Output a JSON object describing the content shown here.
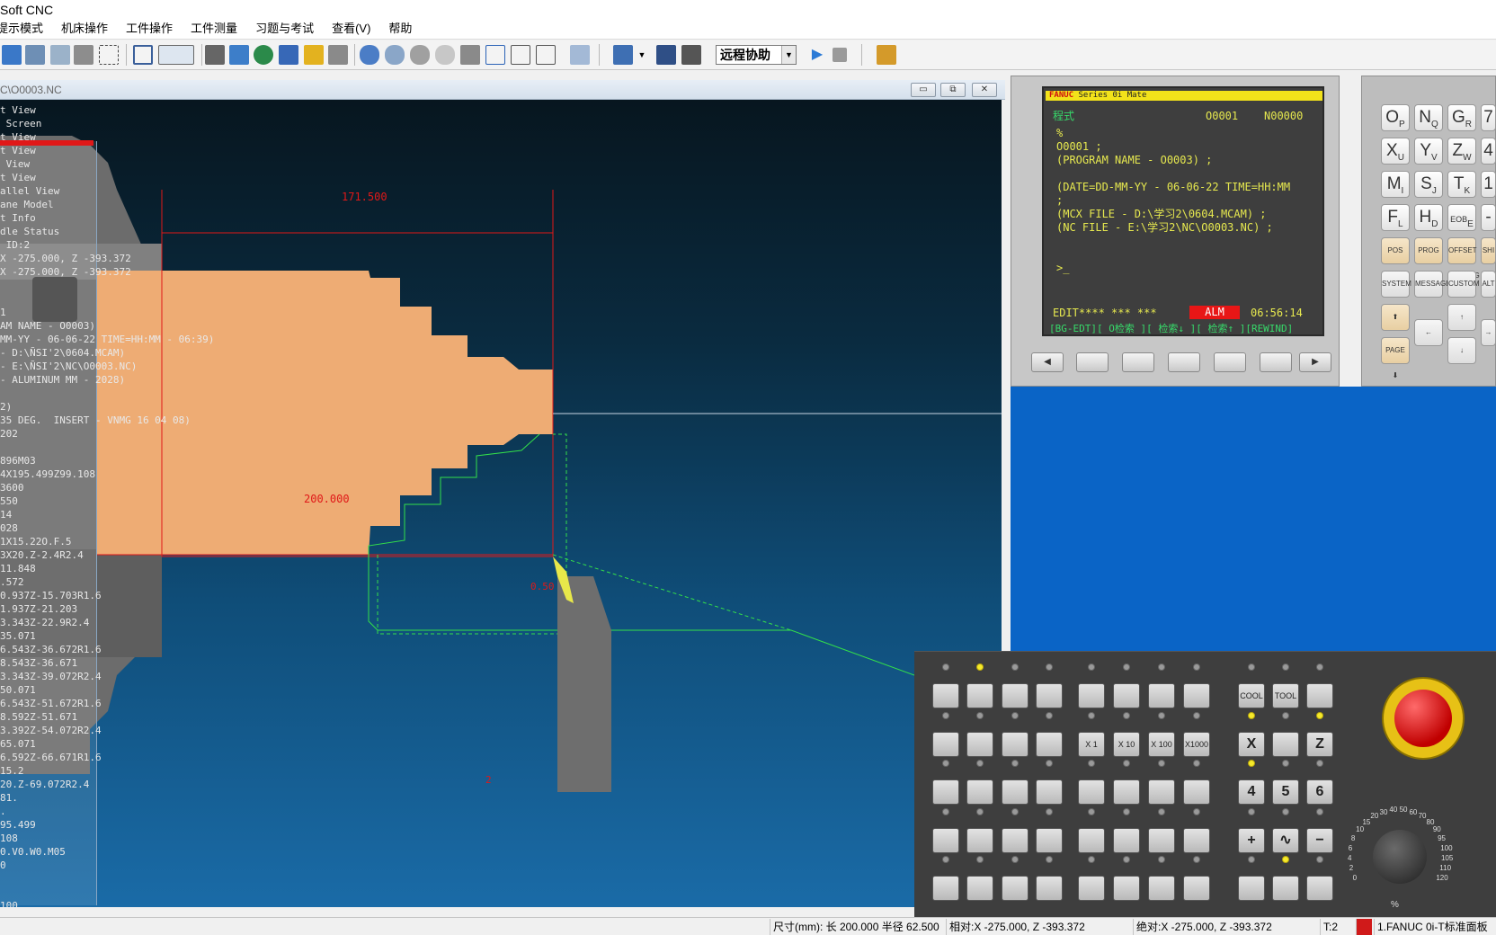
{
  "app": {
    "title": "Soft CNC"
  },
  "menu": [
    "提示模式",
    "机床操作",
    "工件操作",
    "工件测量",
    "习题与考试",
    "查看(V)",
    "帮助"
  ],
  "toolbar": {
    "mode_select": "远程协助"
  },
  "viewport": {
    "title": "C\\O0003.NC",
    "buttons": {
      "minimize": "▭",
      "restore": "⧉",
      "close": "✕"
    },
    "overlay_lines": [
      "t View",
      " Screen",
      "t View",
      "t View",
      " View",
      "t View",
      "allel View",
      "ane Model",
      "t Info",
      "dle Status",
      " ID:2",
      "X -275.000, Z -393.372",
      "X -275.000, Z -393.372",
      "",
      "",
      "1",
      "AM NAME - O0003)",
      "MM-YY - 06-06-22 TIME=HH:MM - 06:39)",
      "- D:\\ÑSI'2\\0604.MCAM)",
      "- E:\\ÑSI'2\\NC\\O0003.NC)",
      "- ALUMINUM MM - 2028)",
      "",
      "2)",
      "35 DEG.  INSERT - VNMG 16 04 08)",
      "202",
      "",
      "896M03",
      "4X195.499Z99.108",
      "3600",
      "550",
      "14",
      "028",
      "1X15.22O.F.5",
      "3X20.Z-2.4R2.4",
      "11.848",
      ".572",
      "0.937Z-15.703R1.6",
      "1.937Z-21.203",
      "3.343Z-22.9R2.4",
      "35.071",
      "6.543Z-36.672R1.6",
      "8.543Z-36.671",
      "3.343Z-39.072R2.4",
      "50.071",
      "6.543Z-51.672R1.6",
      "8.592Z-51.671",
      "3.392Z-54.072R2.4",
      "65.071",
      "6.592Z-66.671R1.6",
      "15.2",
      "20.Z-69.072R2.4",
      "81.",
      ".",
      "95.499",
      "108",
      "0.V0.W0.M05",
      "0",
      "",
      "",
      "100"
    ],
    "dims": {
      "top": "171.500",
      "diameter": "200.000",
      "small": "0.50",
      "marker": "2"
    }
  },
  "cnc_screen": {
    "brand": "FANUC",
    "series": "Series 0i Mate",
    "mode_label": "程式",
    "program_no": "O0001",
    "seq_no": "N00000",
    "lines": [
      "%",
      "O0001 ;",
      "(PROGRAM NAME - O0003) ;",
      "",
      "(DATE=DD-MM-YY - 06-06-22 TIME=HH:MM",
      ";",
      "(MCX FILE - D:\\学习2\\0604.MCAM) ;",
      "(NC FILE - E:\\学习2\\NC\\O0003.NC) ;",
      "",
      "",
      ">_"
    ],
    "status_left": "EDIT**** ***    ***",
    "alarm": "ALM",
    "time": "06:56:14",
    "softkey_labels": "[BG-EDT][ O检索 ][ 检索↓ ][ 检索↑ ][REWIND]"
  },
  "keypad": {
    "rows": [
      [
        {
          "m": "O",
          "s": "P"
        },
        {
          "m": "N",
          "s": "Q"
        },
        {
          "m": "G",
          "s": "R"
        },
        {
          "m": "7",
          "s": ""
        }
      ],
      [
        {
          "m": "X",
          "s": "U"
        },
        {
          "m": "Y",
          "s": "V"
        },
        {
          "m": "Z",
          "s": "W"
        },
        {
          "m": "4",
          "s": ""
        }
      ],
      [
        {
          "m": "M",
          "s": "I"
        },
        {
          "m": "S",
          "s": "J"
        },
        {
          "m": "T",
          "s": "K"
        },
        {
          "m": "1",
          "s": ""
        }
      ],
      [
        {
          "m": "F",
          "s": "L"
        },
        {
          "m": "H",
          "s": "D"
        },
        {
          "m": "EOB",
          "s": "E"
        },
        {
          "m": "-",
          "s": ""
        }
      ]
    ],
    "func": [
      "POS",
      "PROG",
      "OFFSET SETTING",
      "SHI"
    ],
    "func2": [
      "SYSTEM",
      "MESSAGE",
      "CUSTOM GRAPH",
      "ALT"
    ],
    "page_up": "PAGE",
    "page_down": "PAGE"
  },
  "operator_panel": {
    "cool": "COOL",
    "tool": "TOOL",
    "x1": "X 1",
    "x10": "X 10",
    "x100": "X 100",
    "x1000": "X1000",
    "axis_x": "X",
    "axis_z": "Z",
    "n4": "4",
    "n5": "5",
    "n6": "6",
    "plus": "+",
    "minus": "−",
    "dial_scale": [
      "0",
      "2",
      "4",
      "6",
      "8",
      "10",
      "15",
      "20",
      "30",
      "40",
      "50",
      "60",
      "70",
      "80",
      "90",
      "95",
      "100",
      "105",
      "110",
      "120"
    ],
    "dial_unit": "%"
  },
  "statusbar": {
    "dims": "尺寸(mm): 长 200.000 半径 62.500",
    "relative": "相对:X -275.000, Z -393.372",
    "absolute": "绝对:X -275.000, Z -393.372",
    "tool": "T:2",
    "panel": "1.FANUC 0i-T标准面板"
  },
  "colors": {
    "workpiece": "#eeac74",
    "accent_red": "#ff0000",
    "cnc_yellow": "#e6e84f",
    "cnc_green": "#37d96a",
    "alarm": "#e81616"
  }
}
